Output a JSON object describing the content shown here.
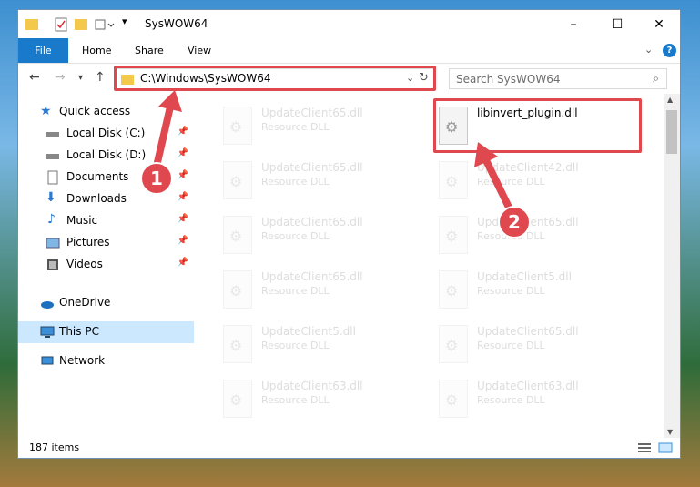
{
  "window": {
    "title": "SysWOW64",
    "controls": {
      "minimize": "–",
      "maximize": "☐",
      "close": "✕"
    }
  },
  "ribbon": {
    "tabs": [
      {
        "label": "File"
      },
      {
        "label": "Home"
      },
      {
        "label": "Share"
      },
      {
        "label": "View"
      }
    ]
  },
  "address": {
    "path": "C:\\Windows\\SysWOW64"
  },
  "search": {
    "placeholder": "Search SysWOW64"
  },
  "sidebar": {
    "items": [
      {
        "label": "Quick access",
        "icon": "star-icon"
      },
      {
        "label": "Local Disk (C:)",
        "icon": "drive-icon"
      },
      {
        "label": "Local Disk (D:)",
        "icon": "drive-icon"
      },
      {
        "label": "Documents",
        "icon": "document-icon"
      },
      {
        "label": "Downloads",
        "icon": "download-icon"
      },
      {
        "label": "Music",
        "icon": "music-icon"
      },
      {
        "label": "Pictures",
        "icon": "pictures-icon"
      },
      {
        "label": "Videos",
        "icon": "video-icon"
      },
      {
        "label": "OneDrive",
        "icon": "cloud-icon"
      },
      {
        "label": "This PC",
        "icon": "computer-icon"
      },
      {
        "label": "Network",
        "icon": "network-icon"
      }
    ]
  },
  "files": {
    "highlighted": {
      "name": "libinvert_plugin.dll"
    },
    "left": [
      {
        "name": "UpdateClient65.dll",
        "type": "Resource DLL"
      },
      {
        "name": "UpdateClient65.dll",
        "type": "Resource DLL"
      },
      {
        "name": "UpdateClient65.dll",
        "type": "Resource DLL"
      },
      {
        "name": "UpdateClient65.dll",
        "type": "Resource DLL"
      },
      {
        "name": "UpdateClient5.dll",
        "type": "Resource DLL"
      },
      {
        "name": "UpdateClient63.dll",
        "type": "Resource DLL"
      }
    ],
    "right": [
      {
        "name": "UpdateClient42.dll",
        "type": "Resource DLL"
      },
      {
        "name": "UpdateClient65.dll",
        "type": "Resource DLL"
      },
      {
        "name": "UpdateClient5.dll",
        "type": "Resource DLL"
      },
      {
        "name": "UpdateClient65.dll",
        "type": "Resource DLL"
      },
      {
        "name": "UpdateClient63.dll",
        "type": "Resource DLL"
      }
    ]
  },
  "annotations": {
    "step1": "1",
    "step2": "2",
    "color": "#e0484f"
  },
  "status": {
    "items_count": "187 items"
  }
}
